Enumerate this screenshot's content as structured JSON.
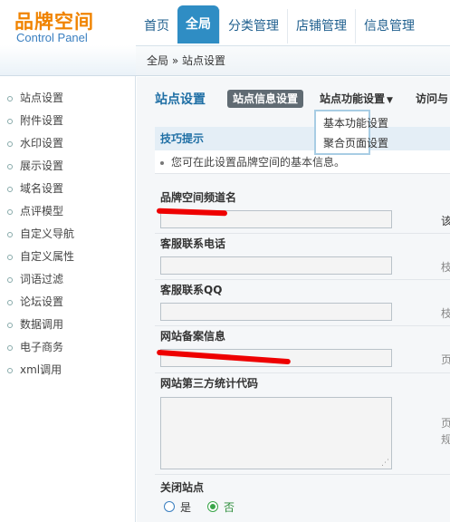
{
  "logo": {
    "title": "品牌空间",
    "subtitle": "Control Panel"
  },
  "nav": {
    "tabs": [
      "首页",
      "全局",
      "分类管理",
      "店铺管理",
      "信息管理"
    ]
  },
  "breadcrumb": {
    "text": "全局 » 站点设置"
  },
  "sidebar": {
    "items": [
      "站点设置",
      "附件设置",
      "水印设置",
      "展示设置",
      "域名设置",
      "点评模型",
      "自定义导航",
      "自定义属性",
      "词语过滤",
      "论坛设置",
      "数据调用",
      "电子商务",
      "xml调用"
    ]
  },
  "page": {
    "title": "站点设置",
    "subtabs": [
      "站点信息设置",
      "站点功能设置",
      "访问与"
    ],
    "dropdown": [
      "基本功能设置",
      "聚合页面设置"
    ]
  },
  "tips": {
    "title": "技巧提示",
    "text": "您可在此设置品牌空间的基本信息。"
  },
  "fields": {
    "channel_name": {
      "label": "品牌空间频道名",
      "hint": "该"
    },
    "phone": {
      "label": "客服联系电话",
      "hint": "枝"
    },
    "qq": {
      "label": "客服联系QQ",
      "hint": "枝"
    },
    "icp": {
      "label": "网站备案信息",
      "hint": "页"
    },
    "stats": {
      "label": "网站第三方统计代码",
      "hint1": "页",
      "hint2": "规"
    },
    "close_site": {
      "label": "关闭站点",
      "yes": "是",
      "no": "否"
    }
  },
  "colors": {
    "accent": "#2f8dc4",
    "brand": "#f08300",
    "redact": "#ee0000"
  }
}
